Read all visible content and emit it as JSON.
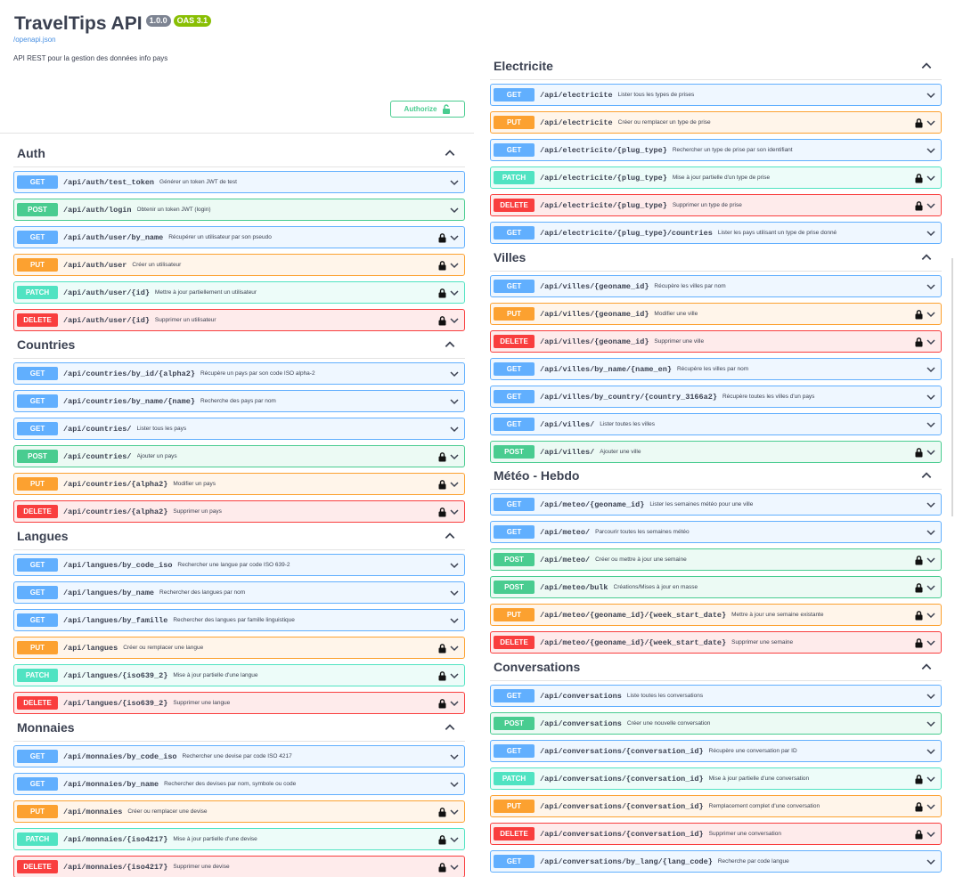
{
  "info": {
    "title": "TravelTips API",
    "version": "1.0.0",
    "oas": "OAS 3.1",
    "spec_url": "/openapi.json",
    "description": "API REST pour la gestion des données info pays",
    "authorize_label": "Authorize"
  },
  "colors": {
    "get": "#61affe",
    "post": "#49cc90",
    "put": "#fca130",
    "patch": "#50e3c2",
    "delete": "#f93e3e"
  },
  "sections": {
    "auth": {
      "name": "Auth",
      "ops": [
        {
          "method": "GET",
          "path": "/api/auth/test_token",
          "summary": "Générer un token JWT de test",
          "locked": false
        },
        {
          "method": "POST",
          "path": "/api/auth/login",
          "summary": "Obtenir un token JWT (login)",
          "locked": false
        },
        {
          "method": "GET",
          "path": "/api/auth/user/by_name",
          "summary": "Récupérer un utilisateur par son pseudo",
          "locked": true
        },
        {
          "method": "PUT",
          "path": "/api/auth/user",
          "summary": "Créer un utilisateur",
          "locked": true
        },
        {
          "method": "PATCH",
          "path": "/api/auth/user/{id}",
          "summary": "Mettre à jour partiellement un utilisateur",
          "locked": true
        },
        {
          "method": "DELETE",
          "path": "/api/auth/user/{id}",
          "summary": "Supprimer un utilisateur",
          "locked": true
        }
      ]
    },
    "countries": {
      "name": "Countries",
      "ops": [
        {
          "method": "GET",
          "path": "/api/countries/by_id/{alpha2}",
          "summary": "Récupère un pays par son code ISO alpha-2",
          "locked": false
        },
        {
          "method": "GET",
          "path": "/api/countries/by_name/{name}",
          "summary": "Recherche des pays par nom",
          "locked": false
        },
        {
          "method": "GET",
          "path": "/api/countries/",
          "summary": "Lister tous les pays",
          "locked": false
        },
        {
          "method": "POST",
          "path": "/api/countries/",
          "summary": "Ajouter un pays",
          "locked": true
        },
        {
          "method": "PUT",
          "path": "/api/countries/{alpha2}",
          "summary": "Modifier un pays",
          "locked": true
        },
        {
          "method": "DELETE",
          "path": "/api/countries/{alpha2}",
          "summary": "Supprimer un pays",
          "locked": true
        }
      ]
    },
    "langues": {
      "name": "Langues",
      "ops": [
        {
          "method": "GET",
          "path": "/api/langues/by_code_iso",
          "summary": "Rechercher une langue par code ISO 639-2",
          "locked": false
        },
        {
          "method": "GET",
          "path": "/api/langues/by_name",
          "summary": "Rechercher des langues par nom",
          "locked": false
        },
        {
          "method": "GET",
          "path": "/api/langues/by_famille",
          "summary": "Rechercher des langues par famille linguistique",
          "locked": false
        },
        {
          "method": "PUT",
          "path": "/api/langues",
          "summary": "Créer ou remplacer une langue",
          "locked": true
        },
        {
          "method": "PATCH",
          "path": "/api/langues/{iso639_2}",
          "summary": "Mise à jour partielle d'une langue",
          "locked": true
        },
        {
          "method": "DELETE",
          "path": "/api/langues/{iso639_2}",
          "summary": "Supprimer une langue",
          "locked": true
        }
      ]
    },
    "monnaies": {
      "name": "Monnaies",
      "ops": [
        {
          "method": "GET",
          "path": "/api/monnaies/by_code_iso",
          "summary": "Rechercher une devise par code ISO 4217",
          "locked": false
        },
        {
          "method": "GET",
          "path": "/api/monnaies/by_name",
          "summary": "Rechercher des devises par nom, symbole ou code",
          "locked": false
        },
        {
          "method": "PUT",
          "path": "/api/monnaies",
          "summary": "Créer ou remplacer une devise",
          "locked": true
        },
        {
          "method": "PATCH",
          "path": "/api/monnaies/{iso4217}",
          "summary": "Mise à jour partielle d'une devise",
          "locked": true
        },
        {
          "method": "DELETE",
          "path": "/api/monnaies/{iso4217}",
          "summary": "Supprimer une devise",
          "locked": true
        }
      ]
    },
    "electricite": {
      "name": "Electricite",
      "ops": [
        {
          "method": "GET",
          "path": "/api/electricite",
          "summary": "Lister tous les types de prises",
          "locked": false
        },
        {
          "method": "PUT",
          "path": "/api/electricite",
          "summary": "Créer ou remplacer un type de prise",
          "locked": true
        },
        {
          "method": "GET",
          "path": "/api/electricite/{plug_type}",
          "summary": "Rechercher un type de prise par son identifiant",
          "locked": false
        },
        {
          "method": "PATCH",
          "path": "/api/electricite/{plug_type}",
          "summary": "Mise à jour partielle d'un type de prise",
          "locked": true
        },
        {
          "method": "DELETE",
          "path": "/api/electricite/{plug_type}",
          "summary": "Supprimer un type de prise",
          "locked": true
        },
        {
          "method": "GET",
          "path": "/api/electricite/{plug_type}/countries",
          "summary": "Lister les pays utilisant un type de prise donné",
          "locked": false
        }
      ]
    },
    "villes": {
      "name": "Villes",
      "ops": [
        {
          "method": "GET",
          "path": "/api/villes/{geoname_id}",
          "summary": "Récupère les villes par nom",
          "locked": false
        },
        {
          "method": "PUT",
          "path": "/api/villes/{geoname_id}",
          "summary": "Modifier une ville",
          "locked": true
        },
        {
          "method": "DELETE",
          "path": "/api/villes/{geoname_id}",
          "summary": "Supprimer une ville",
          "locked": true
        },
        {
          "method": "GET",
          "path": "/api/villes/by_name/{name_en}",
          "summary": "Récupère les villes par nom",
          "locked": false
        },
        {
          "method": "GET",
          "path": "/api/villes/by_country/{country_3166a2}",
          "summary": "Récupère toutes les villes d'un pays",
          "locked": false
        },
        {
          "method": "GET",
          "path": "/api/villes/",
          "summary": "Lister toutes les villes",
          "locked": false
        },
        {
          "method": "POST",
          "path": "/api/villes/",
          "summary": "Ajouter une ville",
          "locked": true
        }
      ]
    },
    "meteo": {
      "name": "Météo - Hebdo",
      "ops": [
        {
          "method": "GET",
          "path": "/api/meteo/{geoname_id}",
          "summary": "Lister les semaines météo pour une ville",
          "locked": false
        },
        {
          "method": "GET",
          "path": "/api/meteo/",
          "summary": "Parcourir toutes les semaines météo",
          "locked": false
        },
        {
          "method": "POST",
          "path": "/api/meteo/",
          "summary": "Créer ou mettre à jour une semaine",
          "locked": true
        },
        {
          "method": "POST",
          "path": "/api/meteo/bulk",
          "summary": "Créations/Mises à jour en masse",
          "locked": true
        },
        {
          "method": "PUT",
          "path": "/api/meteo/{geoname_id}/{week_start_date}",
          "summary": "Mettre à jour une semaine existante",
          "locked": true
        },
        {
          "method": "DELETE",
          "path": "/api/meteo/{geoname_id}/{week_start_date}",
          "summary": "Supprimer une semaine",
          "locked": true
        }
      ]
    },
    "conversations": {
      "name": "Conversations",
      "ops": [
        {
          "method": "GET",
          "path": "/api/conversations",
          "summary": "Liste toutes les conversations",
          "locked": false
        },
        {
          "method": "POST",
          "path": "/api/conversations",
          "summary": "Créer une nouvelle conversation",
          "locked": false
        },
        {
          "method": "GET",
          "path": "/api/conversations/{conversation_id}",
          "summary": "Récupère une conversation par ID",
          "locked": false
        },
        {
          "method": "PATCH",
          "path": "/api/conversations/{conversation_id}",
          "summary": "Mise à jour partielle d'une conversation",
          "locked": true
        },
        {
          "method": "PUT",
          "path": "/api/conversations/{conversation_id}",
          "summary": "Remplacement complet d'une conversation",
          "locked": true
        },
        {
          "method": "DELETE",
          "path": "/api/conversations/{conversation_id}",
          "summary": "Supprimer une conversation",
          "locked": true
        },
        {
          "method": "GET",
          "path": "/api/conversations/by_lang/{lang_code}",
          "summary": "Recherche par code langue",
          "locked": false
        }
      ]
    }
  }
}
